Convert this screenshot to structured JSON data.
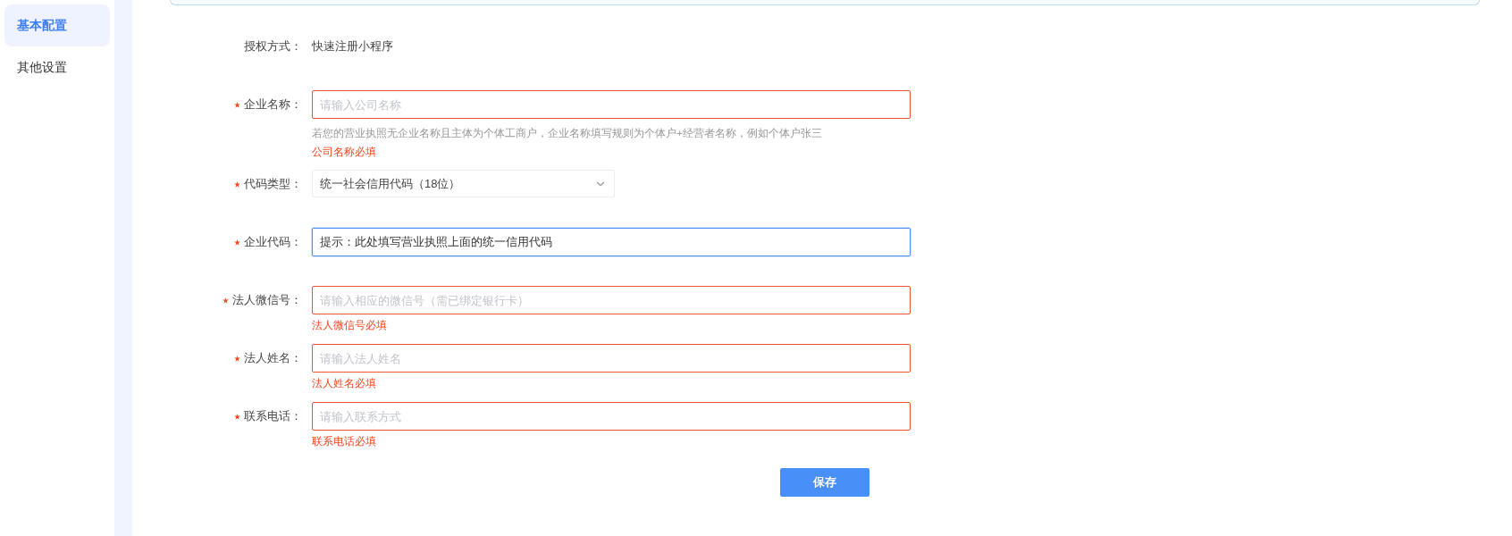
{
  "sidebar": {
    "items": [
      {
        "label": "基本配置",
        "selected": true
      },
      {
        "label": "其他设置",
        "selected": false
      }
    ]
  },
  "form": {
    "fields": [
      {
        "kind": "static",
        "label": "授权方式：",
        "required": false,
        "value": "快速注册小程序"
      },
      {
        "kind": "text",
        "label": "企业名称：",
        "required": true,
        "placeholder": "请输入公司名称",
        "error": true,
        "focused": false,
        "help": "若您的营业执照无企业名称且主体为个体工商户，企业名称填写规则为个体户+经营者名称，例如个体户张三",
        "message": "公司名称必填"
      },
      {
        "kind": "select",
        "label": "代码类型：",
        "required": true,
        "value": "统一社会信用代码（18位）"
      },
      {
        "kind": "text",
        "label": "企业代码：",
        "required": true,
        "value": "提示：此处填写营业执照上面的统一信用代码",
        "error": false,
        "focused": true
      },
      {
        "kind": "text",
        "label": "法人微信号：",
        "required": true,
        "placeholder": "请输入相应的微信号（需已绑定银行卡）",
        "error": true,
        "focused": false,
        "message": "法人微信号必填"
      },
      {
        "kind": "text",
        "label": "法人姓名：",
        "required": true,
        "placeholder": "请输入法人姓名",
        "error": true,
        "focused": false,
        "message": "法人姓名必填"
      },
      {
        "kind": "text",
        "label": "联系电话：",
        "required": true,
        "placeholder": "请输入联系方式",
        "error": true,
        "focused": false,
        "message": "联系电话必填"
      }
    ],
    "save_button": "保存"
  }
}
